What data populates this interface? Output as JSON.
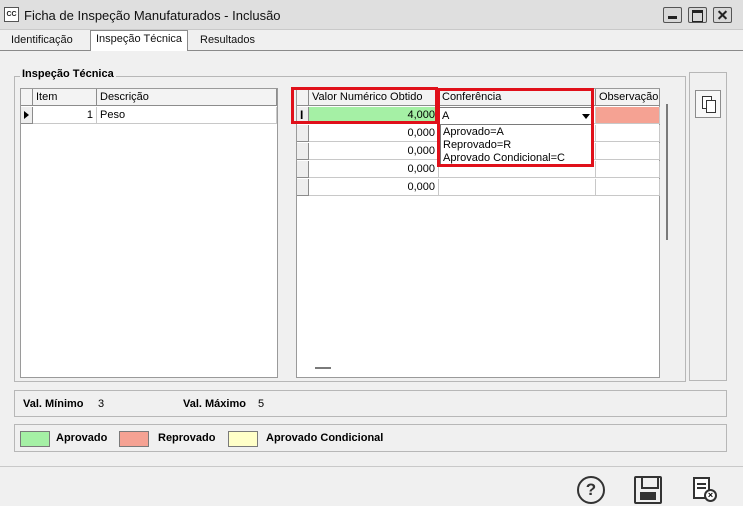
{
  "window": {
    "app_icon": "CC",
    "title": "Ficha de Inspeção Manufaturados - Inclusão"
  },
  "tabs": [
    {
      "label": "Identificação",
      "active": false
    },
    {
      "label": "Inspeção Técnica",
      "active": true
    },
    {
      "label": "Resultados",
      "active": false
    }
  ],
  "group": {
    "title": "Inspeção Técnica"
  },
  "left_grid": {
    "headers": [
      "Item",
      "Descrição"
    ],
    "rows": [
      {
        "item": "1",
        "descricao": "Peso"
      }
    ]
  },
  "right_grid": {
    "headers": [
      "Valor Numérico Obtido",
      "Conferência",
      "Observação"
    ],
    "values": [
      "4,000",
      "0,000",
      "0,000",
      "0,000",
      "0,000"
    ],
    "conferencia_current": "A",
    "row_colors": {
      "approved": "#a5f0a5",
      "rejected": "#f5a293"
    }
  },
  "dropdown": {
    "options": [
      "Aprovado=A",
      "Reprovado=R",
      "Aprovado Condicional=C"
    ]
  },
  "limits": {
    "min_label": "Val. Mínimo",
    "min_value": "3",
    "max_label": "Val. Máximo",
    "max_value": "5"
  },
  "legend": {
    "items": [
      {
        "label": "Aprovado",
        "color": "#a5f0a5"
      },
      {
        "label": "Reprovado",
        "color": "#f5a293"
      },
      {
        "label": "Aprovado Condicional",
        "color": "#ffffc8"
      }
    ]
  },
  "icons": {
    "help": "question-circle-icon",
    "save": "floppy-disk-icon",
    "cancel": "document-cancel-icon",
    "copy": "copy-pages-icon"
  },
  "highlight_color": "#e0101a"
}
